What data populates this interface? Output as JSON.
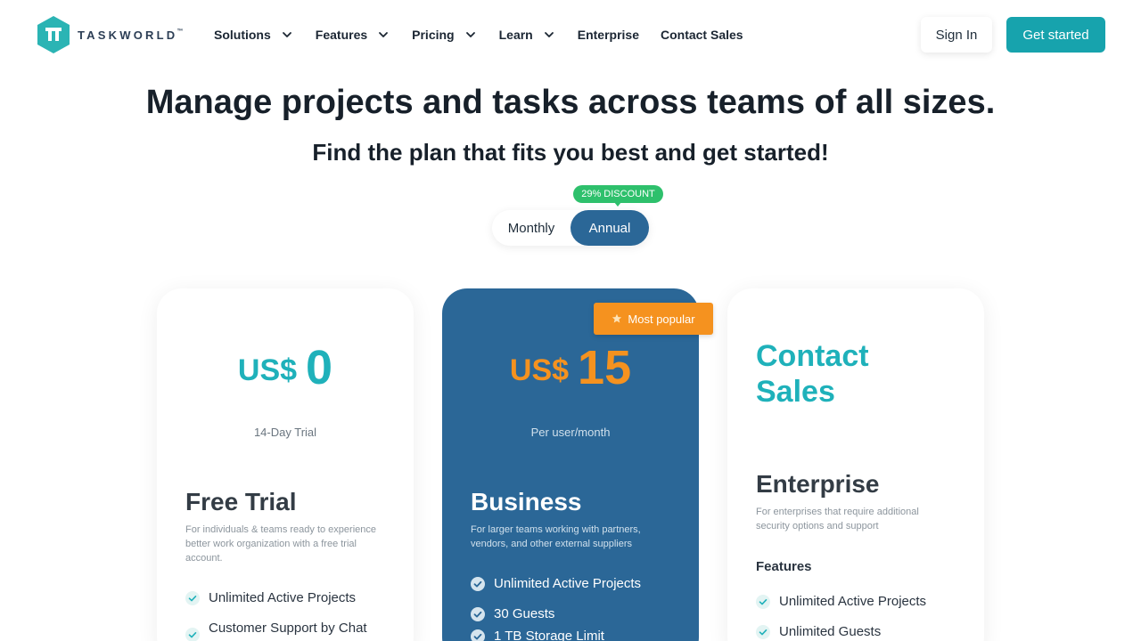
{
  "brand": {
    "name": "TASKWORLD",
    "tm": "™",
    "color": "#17a3ad"
  },
  "nav": {
    "items": [
      {
        "label": "Solutions",
        "has_dropdown": true
      },
      {
        "label": "Features",
        "has_dropdown": true
      },
      {
        "label": "Pricing",
        "has_dropdown": true
      },
      {
        "label": "Learn",
        "has_dropdown": true
      },
      {
        "label": "Enterprise",
        "has_dropdown": false
      },
      {
        "label": "Contact Sales",
        "has_dropdown": false
      }
    ],
    "sign_in": "Sign In",
    "get_started": "Get started"
  },
  "hero": {
    "title": "Manage projects and tasks across teams of all sizes.",
    "subtitle": "Find the plan that fits you best and get started!"
  },
  "billing": {
    "discount_badge": "29% DISCOUNT",
    "options": [
      "Monthly",
      "Annual"
    ],
    "selected": "Annual"
  },
  "plans": {
    "free": {
      "currency": "US$",
      "price": "0",
      "price_note": "14-Day Trial",
      "name": "Free Trial",
      "description": "For individuals & teams ready to experience better work organization with a free trial account.",
      "features": [
        "Unlimited Active Projects",
        "Customer Support by Chat"
      ]
    },
    "business": {
      "badge": "Most popular",
      "currency": "US$",
      "price": "15",
      "price_note": "Per user/month",
      "name": "Business",
      "description": "For larger teams working with partners, vendors, and other external suppliers",
      "features": [
        "Unlimited Active Projects",
        "30 Guests",
        "1 TB Storage Limit"
      ]
    },
    "enterprise": {
      "headline": "Contact Sales",
      "name": "Enterprise",
      "description": "For enterprises that require additional security options and support",
      "features_heading": "Features",
      "features": [
        "Unlimited Active Projects",
        "Unlimited Guests"
      ]
    }
  },
  "colors": {
    "teal": "#17a3ad",
    "blue": "#2b6797",
    "orange": "#f5921f",
    "green": "#2ec06c"
  }
}
